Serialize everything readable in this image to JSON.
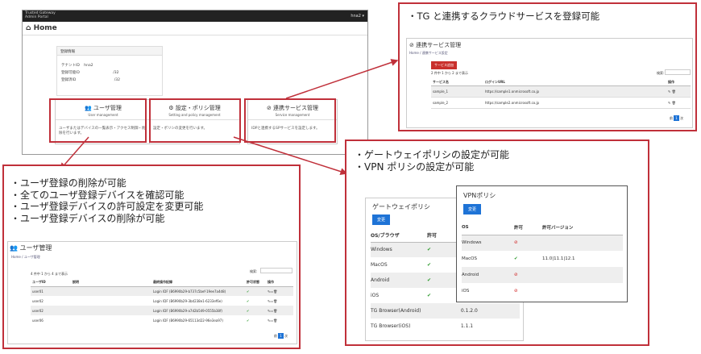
{
  "main": {
    "brand_line1": "Trusted Gateway",
    "brand_line2": "Admin Portal",
    "user": "hna2 ▾",
    "page_title": "Home",
    "info_header": "登録情報",
    "info_rows": [
      {
        "label": "テナントID",
        "value": "hna2"
      },
      {
        "label": "登録可能ID",
        "value": "/32"
      },
      {
        "label": "登録済ID",
        "value": "/32"
      }
    ],
    "cards": [
      {
        "title": "ユーザ管理",
        "subtitle": "User management",
        "desc": "ユーザまたはデバイスの一覧表示・アクセス制御・削除を行います。"
      },
      {
        "title": "設定・ポリシ管理",
        "subtitle": "Setting and policy management",
        "desc": "設定・ポリシの変更を行います。"
      },
      {
        "title": "連携サービス管理",
        "subtitle": "Service management",
        "desc": "IDPと連携するSPサービスを設定します。"
      }
    ]
  },
  "tg_callout": {
    "bullet": "・TG と連携するクラウドサービスを登録可能",
    "title": "連携サービス管理",
    "breadcrumb": "Home / 連携サービス設定",
    "add_button": "サービス追加",
    "count": "2 件中 1 から 2 まで表示",
    "search_label": "検索:",
    "columns": [
      "サービス名",
      "ログインURL",
      "操作"
    ],
    "rows": [
      {
        "name": "sample_1",
        "url": "https://sample1.onmicrosoft.co.jp"
      },
      {
        "name": "sample_2",
        "url": "https://sample2.onmicrosoft.co.jp"
      }
    ],
    "pagination": [
      "前",
      "1",
      "次"
    ]
  },
  "user_callout": {
    "bullets": [
      "・ユーザ登録の削除が可能",
      "・全てのユーザ登録デバイスを確認可能",
      "・ユーザ登録デバイスの許可設定を変更可能",
      "・ユーザ登録デバイスの削除が可能"
    ],
    "title": "ユーザ管理",
    "breadcrumb": "Home / ユーザ管理",
    "count": "4 件中 1 から 4 まで表示",
    "search_label": "検索:",
    "columns": [
      "ユーザID",
      "説明",
      "最終操作記録",
      "許可状態",
      "操作"
    ],
    "rows": [
      {
        "id": "user01",
        "log": "Login IDF (B6990b29-b737c5bef-19ee7a4d8)"
      },
      {
        "id": "user02",
        "log": "Login IDF (B6990b29-3bd238e1-6233ef6e)"
      },
      {
        "id": "user02",
        "log": "Login IDF (B6990b29-a7d2b549-0555b38f)"
      },
      {
        "id": "user06",
        "log": "Login IDF (B6990b29-65113d22-96e3ea97)"
      }
    ],
    "pagination": [
      "前",
      "1",
      "次"
    ]
  },
  "policy_callout": {
    "bullets": [
      "・ゲートウェイポリシの設定が可能",
      "・VPN ポリシの設定が可能"
    ],
    "gw": {
      "title": "ゲートウェイポリシ",
      "button": "変更",
      "columns": [
        "OS/ブラウザ",
        "許可"
      ],
      "rows": [
        {
          "os": "Windows",
          "allow": "✔",
          "ver": ""
        },
        {
          "os": "MacOS",
          "allow": "✔",
          "ver": ""
        },
        {
          "os": "Android",
          "allow": "✔",
          "ver": ""
        },
        {
          "os": "iOS",
          "allow": "✔",
          "ver": ""
        },
        {
          "os": "TG Browser(Android)",
          "allow": "",
          "ver": "0.1.2.0"
        },
        {
          "os": "TG Browser(iOS)",
          "allow": "",
          "ver": "1.1.1"
        }
      ]
    },
    "vpn": {
      "title": "VPNポリシ",
      "button": "変更",
      "columns": [
        "OS",
        "許可",
        "許可バージョン"
      ],
      "rows": [
        {
          "os": "Windows",
          "allow": "⊘",
          "ver": ""
        },
        {
          "os": "MacOS",
          "allow": "✔",
          "ver": "11.0|11.1|12.1"
        },
        {
          "os": "Android",
          "allow": "⊘",
          "ver": ""
        },
        {
          "os": "iOS",
          "allow": "⊘",
          "ver": ""
        }
      ]
    }
  },
  "colors": {
    "callout_border": "#c0303a",
    "add_button": "#c9302c",
    "blue_button": "#1e73d6"
  }
}
